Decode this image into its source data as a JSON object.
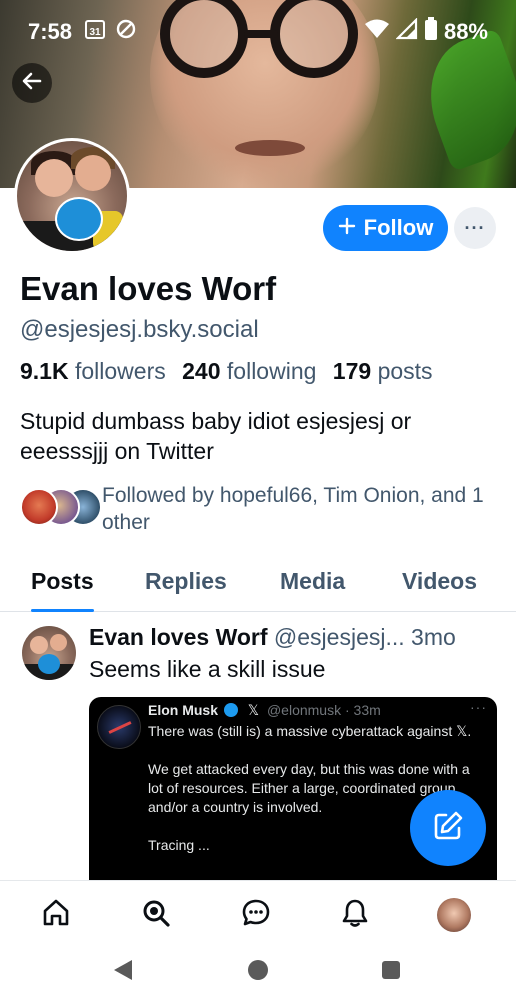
{
  "status_bar": {
    "time": "7:58",
    "calendar_badge": "31",
    "battery": "88%"
  },
  "profile": {
    "display_name": "Evan loves Worf",
    "handle": "@esjesjesj.bsky.social",
    "stats": {
      "followers_count": "9.1K",
      "followers_label": "followers",
      "following_count": "240",
      "following_label": "following",
      "posts_count": "179",
      "posts_label": "posts"
    },
    "bio": "Stupid dumbass baby idiot esjesjesj or eeesssjjj on Twitter",
    "followed_by": "Followed by hopeful66, Tim Onion, and 1 other",
    "follow_label": "Follow",
    "more_label": "···"
  },
  "tabs": [
    {
      "label": "Posts",
      "active": true
    },
    {
      "label": "Replies",
      "active": false
    },
    {
      "label": "Media",
      "active": false
    },
    {
      "label": "Videos",
      "active": false
    }
  ],
  "post": {
    "author": "Evan loves Worf",
    "handle": "@esjesjesj...",
    "time": "3mo",
    "text": "Seems like a skill issue",
    "embed": {
      "name": "Elon Musk",
      "x_glyph": "𝕏",
      "handle_time": "@elonmusk · 33m",
      "dots": "···",
      "body": "There was (still is) a massive cyberattack against 𝕏.\n\nWe get attacked every day, but this was done with a lot of resources. Either a large, coordinated group and/or a country is involved.\n\nTracing ..."
    }
  },
  "colors": {
    "accent": "#1083fe",
    "text_primary": "#0b0f14",
    "text_secondary": "#42576c"
  },
  "icons": {
    "back": "arrow-left-icon",
    "compose": "pencil-square-icon",
    "nav_home": "home-icon",
    "nav_search": "search-icon",
    "nav_chat": "chat-bubble-icon",
    "nav_notifications": "bell-icon"
  }
}
